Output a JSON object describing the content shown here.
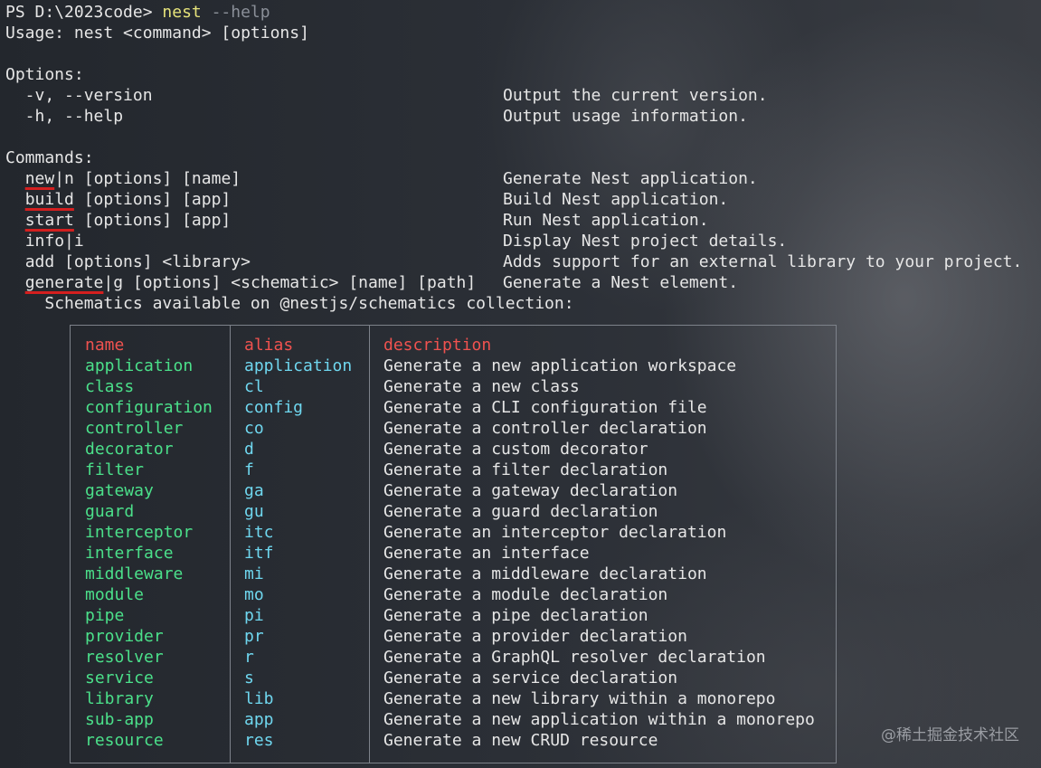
{
  "prompt": {
    "ps": "PS D:\\2023code> ",
    "command": "nest",
    "args": " --help"
  },
  "usage": "Usage: nest <command> [options]",
  "options_header": "Options:",
  "options": [
    {
      "cmd": "  -v, --version",
      "desc": "Output the current version."
    },
    {
      "cmd": "  -h, --help",
      "desc": "Output usage information."
    }
  ],
  "commands_header": "Commands:",
  "commands": {
    "new": {
      "name": "new",
      "alias": "|n",
      "rest": " [options] [name]",
      "desc": "Generate Nest application."
    },
    "build": {
      "name": "build",
      "rest": " [options] [app]",
      "desc": "Build Nest application."
    },
    "start": {
      "name": "start",
      "rest": " [options] [app]",
      "desc": "Run Nest application."
    },
    "info": {
      "text": "info|i",
      "desc": "Display Nest project details."
    },
    "add": {
      "text": "add [options] <library>",
      "desc": "Adds support for an external library to your project."
    },
    "generate": {
      "name": "generate",
      "alias": "|g",
      "rest": " [options] <schematic> [name] [path]",
      "desc": "Generate a Nest element."
    }
  },
  "schematics_line": "Schematics available on @nestjs/schematics collection:",
  "table": {
    "headers": {
      "name": "name",
      "alias": "alias",
      "description": "description"
    },
    "rows": [
      {
        "name": "application",
        "alias": "application",
        "description": "Generate a new application workspace"
      },
      {
        "name": "class",
        "alias": "cl",
        "description": "Generate a new class"
      },
      {
        "name": "configuration",
        "alias": "config",
        "description": "Generate a CLI configuration file"
      },
      {
        "name": "controller",
        "alias": "co",
        "description": "Generate a controller declaration"
      },
      {
        "name": "decorator",
        "alias": "d",
        "description": "Generate a custom decorator"
      },
      {
        "name": "filter",
        "alias": "f",
        "description": "Generate a filter declaration"
      },
      {
        "name": "gateway",
        "alias": "ga",
        "description": "Generate a gateway declaration"
      },
      {
        "name": "guard",
        "alias": "gu",
        "description": "Generate a guard declaration"
      },
      {
        "name": "interceptor",
        "alias": "itc",
        "description": "Generate an interceptor declaration"
      },
      {
        "name": "interface",
        "alias": "itf",
        "description": "Generate an interface"
      },
      {
        "name": "middleware",
        "alias": "mi",
        "description": "Generate a middleware declaration"
      },
      {
        "name": "module",
        "alias": "mo",
        "description": "Generate a module declaration"
      },
      {
        "name": "pipe",
        "alias": "pi",
        "description": "Generate a pipe declaration"
      },
      {
        "name": "provider",
        "alias": "pr",
        "description": "Generate a provider declaration"
      },
      {
        "name": "resolver",
        "alias": "r",
        "description": "Generate a GraphQL resolver declaration"
      },
      {
        "name": "service",
        "alias": "s",
        "description": "Generate a service declaration"
      },
      {
        "name": "library",
        "alias": "lib",
        "description": "Generate a new library within a monorepo"
      },
      {
        "name": "sub-app",
        "alias": "app",
        "description": "Generate a new application within a monorepo"
      },
      {
        "name": "resource",
        "alias": "res",
        "description": "Generate a new CRUD resource"
      }
    ]
  },
  "watermark": "@稀土掘金技术社区",
  "colors": {
    "name_col": "#4be08a",
    "alias_col": "#6fd7ef",
    "header": "#f0524f",
    "command": "#e5e27a",
    "underline": "#d41f1f"
  }
}
